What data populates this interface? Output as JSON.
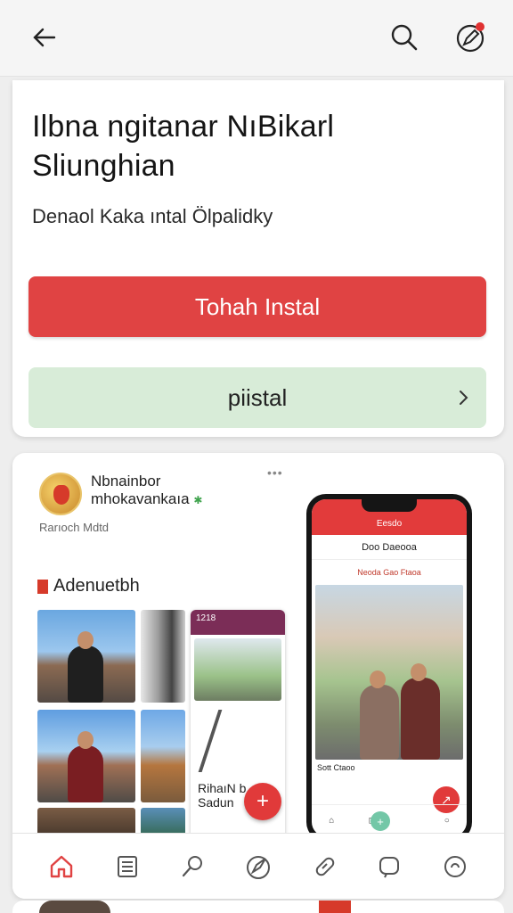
{
  "colors": {
    "accent": "#e04343",
    "secondary_bg": "#d8ecd8",
    "notification": "#e03131"
  },
  "topbar": {
    "back_icon": "back-arrow-icon",
    "search_icon": "search-icon",
    "edit_icon": "compose-icon"
  },
  "hero": {
    "title": "Ilbna ngitanar NıBikarl Sliunghian",
    "subtitle": "Denaol Kaka ıntal Ölpalidky",
    "primary_button": "Tohah Instal",
    "secondary_button": "piistal"
  },
  "feed": {
    "account_name_line1": "Nbnainbor",
    "account_name_line2": "mhokavankaıa",
    "verified_mark": "✱",
    "more_dots": "•••",
    "meta": "Rarıoch Mdtd",
    "section_title": "Adenuetbh",
    "mini_phone": {
      "status": "1218",
      "label_line1": "RihaıN b",
      "label_line2": "Sadun"
    },
    "phone": {
      "screen_title": "Eesdo",
      "header": "Doo Daeooa",
      "row_text": "Neoda Gao Ftaoa",
      "caption": "Sott Ctaoo",
      "corner_text": "ᵉ1▯"
    }
  },
  "bottom_nav": {
    "items": [
      "home-icon",
      "list-icon",
      "search-icon",
      "explore-icon",
      "tag-icon",
      "chat-icon",
      "profile-icon"
    ]
  }
}
